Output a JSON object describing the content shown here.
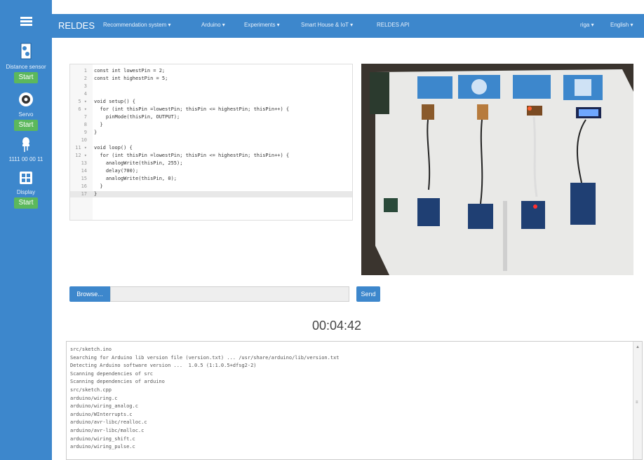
{
  "navbar": {
    "brand": "RELDES",
    "items": [
      {
        "label": "Recommendation system ▾"
      },
      {
        "label": "Arduino ▾"
      },
      {
        "label": "Experiments ▾"
      },
      {
        "label": "Smart House & IoT ▾"
      },
      {
        "label": "RELDES API"
      }
    ],
    "right_items": [
      {
        "label": "riga ▾"
      },
      {
        "label": "English ▾"
      }
    ]
  },
  "sidebar": {
    "menu_icon": "hamburger-icon",
    "devices": [
      {
        "label": "Distance sensor",
        "icon": "distance-sensor-icon",
        "button": "Start"
      },
      {
        "label": "Servo",
        "icon": "servo-icon",
        "button": "Start"
      },
      {
        "label": "1111 00 00 11",
        "icon": "led-icon",
        "button": ""
      },
      {
        "label": "Display",
        "icon": "display-icon",
        "button": "Start"
      }
    ]
  },
  "editor": {
    "lines": [
      {
        "n": "1",
        "text": "const int lowestPin = 2;"
      },
      {
        "n": "2",
        "text": "const int highestPin = 5;"
      },
      {
        "n": "3",
        "text": ""
      },
      {
        "n": "4",
        "text": ""
      },
      {
        "n": "5 ▾",
        "text": "void setup() {"
      },
      {
        "n": "6 ▾",
        "text": "  for (int thisPin =lowestPin; thisPin <= highestPin; thisPin++) {"
      },
      {
        "n": "7",
        "text": "    pinMode(thisPin, OUTPUT);"
      },
      {
        "n": "8",
        "text": "  }"
      },
      {
        "n": "9",
        "text": "}"
      },
      {
        "n": "10",
        "text": ""
      },
      {
        "n": "11 ▾",
        "text": "void loop() {"
      },
      {
        "n": "12 ▾",
        "text": "  for (int thisPin =lowestPin; thisPin <= highestPin; thisPin++) {"
      },
      {
        "n": "13",
        "text": "    analogWrite(thisPin, 255);"
      },
      {
        "n": "14",
        "text": "    delay(700);"
      },
      {
        "n": "15",
        "text": "    analogWrite(thisPin, 0);"
      },
      {
        "n": "16",
        "text": "  }"
      },
      {
        "n": "17",
        "text": "}"
      }
    ],
    "active_line": 17
  },
  "upload": {
    "browse_label": "Browse...",
    "send_label": "Send"
  },
  "timer": "00:04:42",
  "console": {
    "lines": [
      "src/sketch.ino",
      "Searching for Arduino lib version file (version.txt) ... /usr/share/arduino/lib/version.txt",
      "Detecting Arduino software version ...  1.0.5 (1:1.0.5+dfsg2-2)",
      "Scanning dependencies of src",
      "Scanning dependencies of arduino",
      "src/sketch.cpp",
      "arduino/wiring.c",
      "arduino/wiring_analog.c",
      "arduino/WInterrupts.c",
      "arduino/avr-libc/realloc.c",
      "arduino/avr-libc/malloc.c",
      "arduino/wiring_shift.c",
      "arduino/wiring_pulse.c"
    ]
  },
  "colors": {
    "primary": "#3d87cc",
    "start_button": "#5cb85c"
  }
}
